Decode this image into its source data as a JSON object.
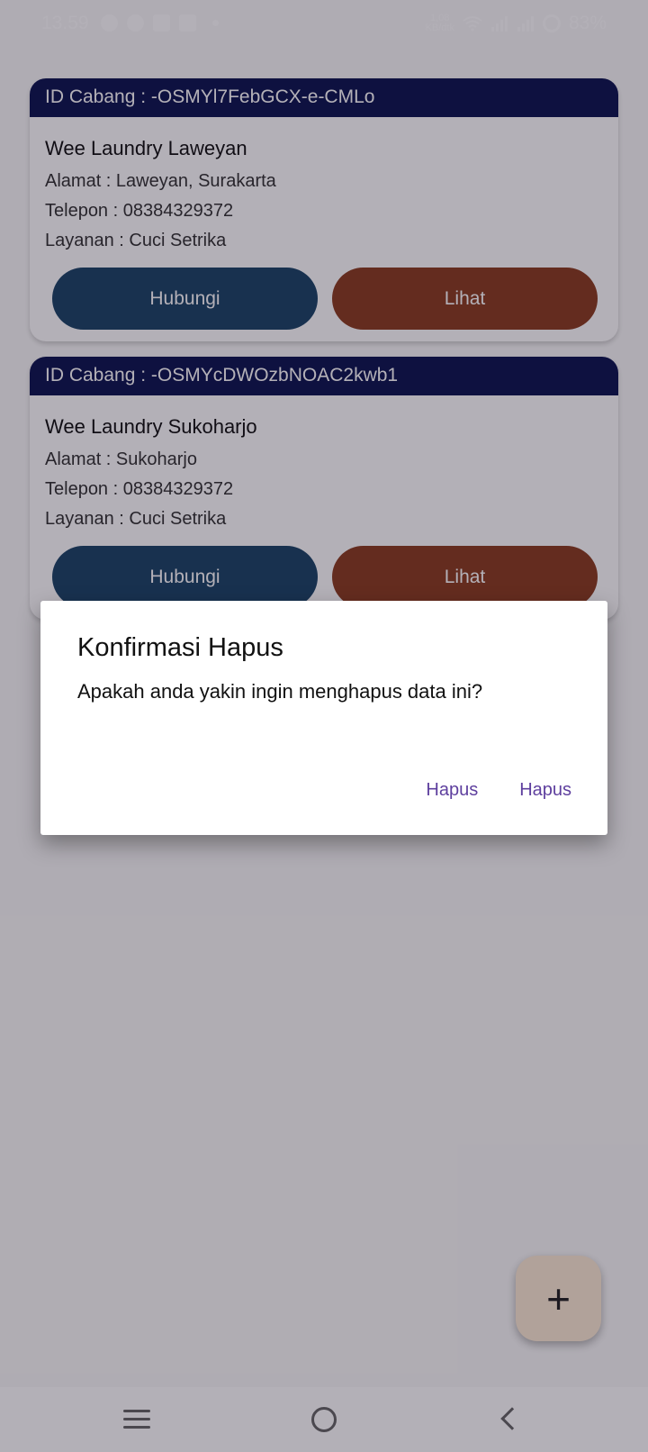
{
  "status_bar": {
    "time": "13.59",
    "notification_icons": [
      "whatsapp-icon",
      "messenger-icon",
      "facebook-icon",
      "cartoon-app-icon"
    ],
    "network_speed_value": "1,08",
    "network_speed_unit": "KB/dtk",
    "battery": "83%"
  },
  "branches": [
    {
      "id_label": "ID Cabang : -OSMYl7FebGCX-e-CMLo",
      "name": "Wee Laundry Laweyan",
      "address": "Alamat : Laweyan, Surakarta",
      "phone": "Telepon : 08384329372",
      "service": "Layanan : Cuci Setrika",
      "contact_label": "Hubungi",
      "view_label": "Lihat"
    },
    {
      "id_label": "ID Cabang : -OSMYcDWOzbNOAC2kwb1",
      "name": "Wee Laundry Sukoharjo",
      "address": "Alamat : Sukoharjo",
      "phone": "Telepon : 08384329372",
      "service": "Layanan : Cuci Setrika",
      "contact_label": "Hubungi",
      "view_label": "Lihat"
    }
  ],
  "fab": {
    "label": "+"
  },
  "dialog": {
    "title": "Konfirmasi Hapus",
    "message": "Apakah anda yakin ingin menghapus data ini?",
    "actions": [
      "Hapus",
      "Hapus"
    ]
  },
  "colors": {
    "card_header": "#0d1550",
    "contact_button": "#1b4466",
    "view_button": "#8b3d20",
    "dialog_action": "#5e3f9e",
    "fab": "#fdebd5"
  }
}
